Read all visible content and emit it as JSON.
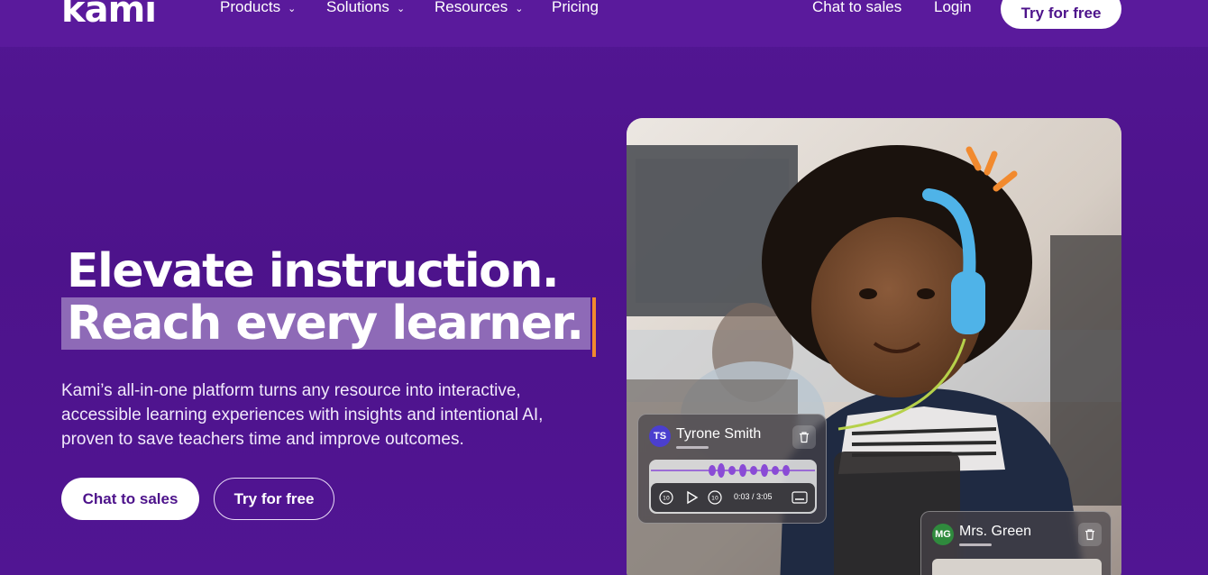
{
  "nav": {
    "logo": "kami",
    "items": [
      {
        "label": "Products",
        "has_dropdown": true
      },
      {
        "label": "Solutions",
        "has_dropdown": true
      },
      {
        "label": "Resources",
        "has_dropdown": true
      },
      {
        "label": "Pricing",
        "has_dropdown": false
      }
    ],
    "chat_label": "Chat to sales",
    "login_label": "Login",
    "cta_label": "Try for free"
  },
  "hero": {
    "line1": "Elevate instruction.",
    "line2": "Reach every learner.",
    "description": "Kami’s all-in-one platform turns any resource into interactive, accessible learning experiences with insights and intentional AI, proven to save teachers time and improve outcomes.",
    "primary_cta": "Chat to sales",
    "secondary_cta": "Try for free"
  },
  "cards": {
    "student": {
      "initials": "TS",
      "name": "Tyrone Smith",
      "time": "0:03 / 3:05"
    },
    "teacher": {
      "initials": "MG",
      "name": "Mrs. Green"
    }
  },
  "colors": {
    "background": "#4d138b",
    "accent_orange": "#f28a2e",
    "highlight": "#8e6ab7",
    "waveform": "#8a4bd6",
    "headphones": "#4fb3e8"
  },
  "icons": [
    "chevron-down-icon",
    "trash-icon",
    "rewind-10-icon",
    "play-icon",
    "forward-10-icon",
    "captions-icon"
  ]
}
